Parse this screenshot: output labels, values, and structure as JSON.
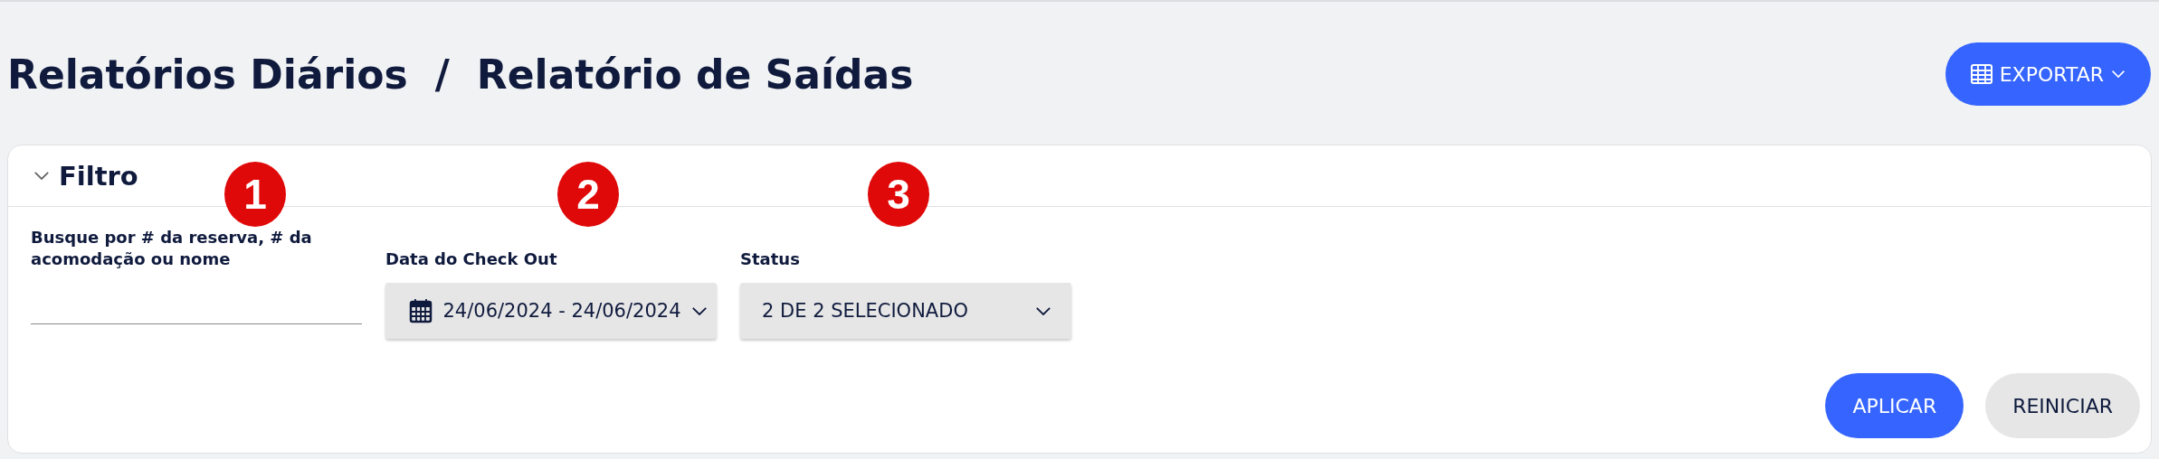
{
  "breadcrumb": [
    "Relatórios Diários",
    "/",
    "Relatório de Saídas"
  ],
  "export_button": {
    "label": "EXPORTAR"
  },
  "filter": {
    "title": "Filtro",
    "expanded": true,
    "fields": [
      {
        "kind": "text",
        "label": "Busque por # da reserva, # da acomodação ou nome"
      },
      {
        "kind": "date",
        "label": "Data do Check Out",
        "value": "24/06/2024 - 24/06/2024"
      },
      {
        "kind": "select",
        "label": "Status",
        "value": "2 DE 2 SELECIONADO"
      }
    ],
    "buttons": [
      {
        "label": "APLICAR",
        "kind": "primary"
      },
      {
        "label": "REINICIAR",
        "kind": "secondary"
      }
    ]
  },
  "markers": [
    "1",
    "2",
    "3"
  ]
}
